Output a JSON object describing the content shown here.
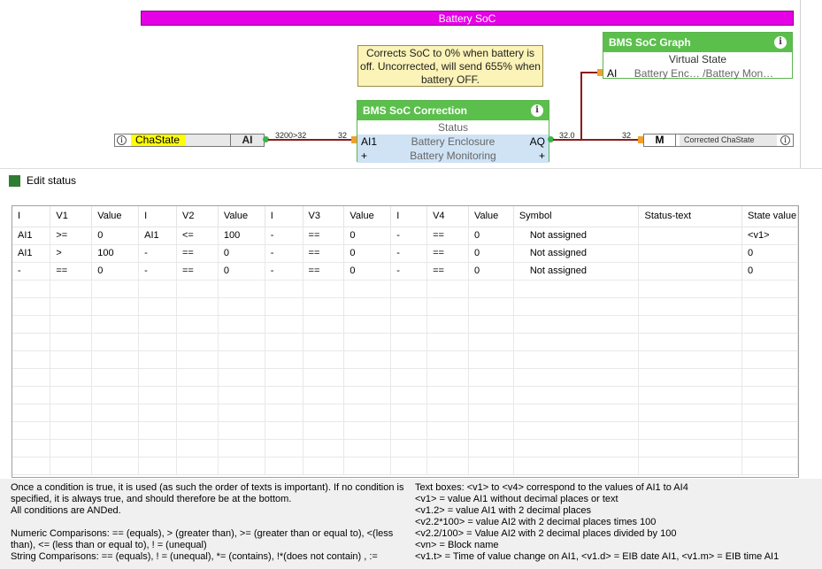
{
  "diagram": {
    "banner": "Battery SoC",
    "note": "Corrects SoC to 0% when battery is off. Uncorrected, will send 655% when battery OFF.",
    "input_block": {
      "name": "ChaState",
      "pin": "AI",
      "info": "i"
    },
    "wire1_label": "3200>32",
    "wire1_in": "32",
    "correction_block": {
      "title": "BMS SoC Correction",
      "status": "Status",
      "in_pin": "AI1",
      "in_label": "Battery Enclosure",
      "out_pin": "AQ",
      "row2_label": "Battery Monitoring",
      "plus": "+"
    },
    "out_value": "32.0",
    "wire2_in": "32",
    "graph_block": {
      "title": "BMS SoC Graph",
      "subtitle": "Virtual State",
      "pin": "AI",
      "label": "Battery Enc… /Battery Mon…"
    },
    "m_block": {
      "pin": "M",
      "label": "Corrected ChaState"
    }
  },
  "dialog": {
    "title": "Edit status"
  },
  "table": {
    "columns": [
      "I",
      "V1",
      "Value",
      "I",
      "V2",
      "Value",
      "I",
      "V3",
      "Value",
      "I",
      "V4",
      "Value",
      "Symbol",
      "Status-text",
      "State value"
    ],
    "rows": [
      [
        "AI1",
        ">=",
        "0",
        "AI1",
        "<=",
        "100",
        "-",
        "==",
        "0",
        "-",
        "==",
        "0",
        "Not assigned",
        "",
        "<v1>"
      ],
      [
        "AI1",
        ">",
        "100",
        "-",
        "==",
        "0",
        "-",
        "==",
        "0",
        "-",
        "==",
        "0",
        "Not assigned",
        "",
        "0"
      ],
      [
        "-",
        "==",
        "0",
        "-",
        "==",
        "0",
        "-",
        "==",
        "0",
        "-",
        "==",
        "0",
        "Not assigned",
        "",
        "0"
      ]
    ]
  },
  "footer": {
    "left": [
      "Once a condition is true, it is used (as such the order of texts is important). If no condition is specified, it is always true, and should therefore be at the bottom.",
      "All conditions are ANDed.",
      "",
      "Numeric Comparisons: == (equals), > (greater than), >= (greater than or equal to), <(less than), <= (less than or equal to), ! = (unequal)",
      "String Comparisons: == (equals), ! = (unequal), *= (contains), !*(does not contain) , :="
    ],
    "right": [
      "Text boxes: <v1> to <v4> correspond to the values of AI1 to AI4",
      "<v1> = value AI1 without decimal places or text",
      "<v1.2> = value AI1 with 2 decimal places",
      "<v2.2*100> = value AI2 with 2 decimal places times 100",
      "<v2.2/100> = Value AI2 with 2 decimal places divided by 100",
      "<vn> = Block name",
      "<v1.t> = Time of value change on AI1, <v1.d> = EIB date AI1, <v1.m> = EIB time AI1"
    ]
  }
}
